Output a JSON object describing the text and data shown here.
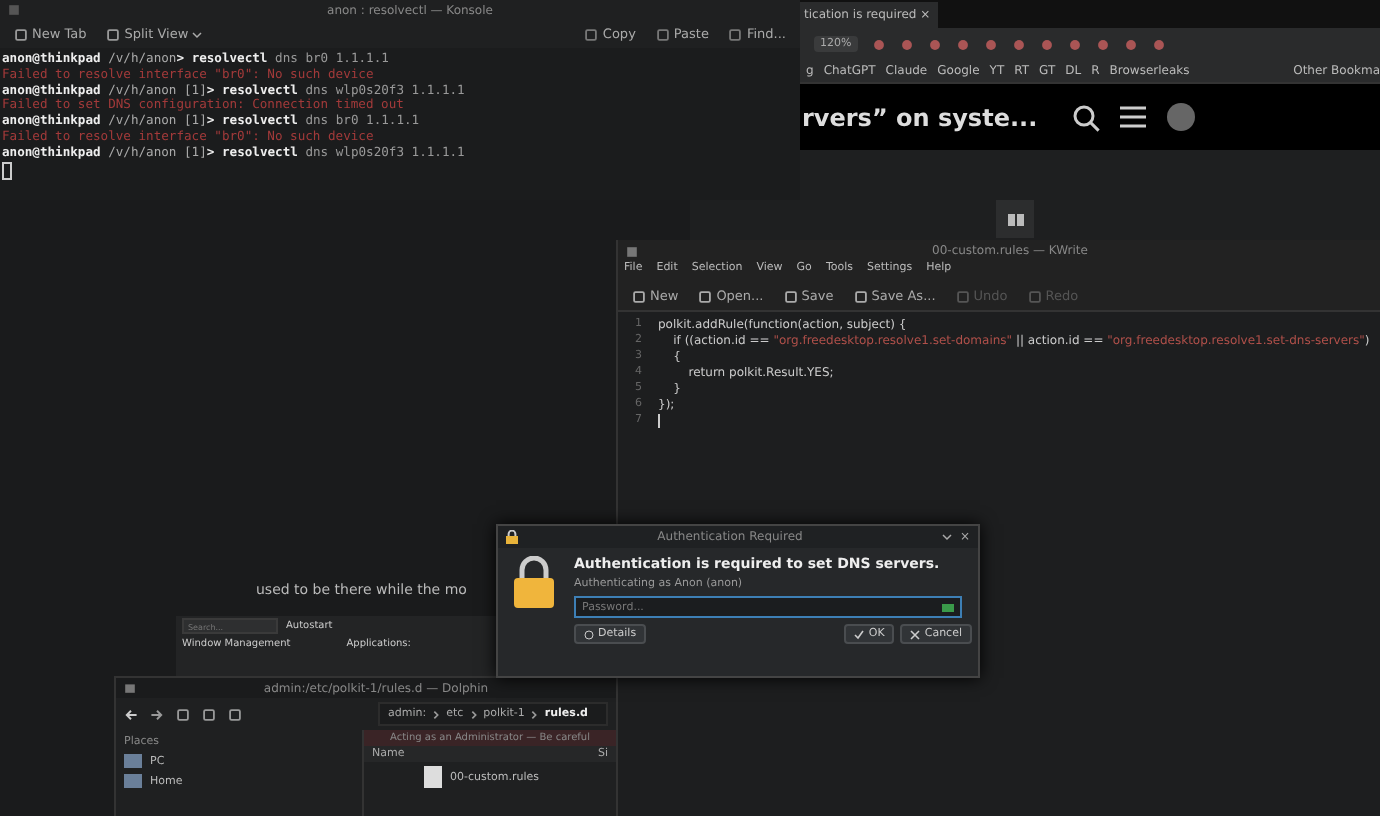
{
  "browser": {
    "tab": {
      "label": "tication is required",
      "close": "×",
      "selected": true
    },
    "zoom": "120%",
    "bookmarks": [
      "g",
      "ChatGPT",
      "Claude",
      "Google",
      "YT",
      "RT",
      "GT",
      "DL",
      "R",
      "Browserleaks"
    ],
    "other_bookmarks": "Other Bookma",
    "page_heading": "rvers” on syste...",
    "page_text": "used to be there while the mo"
  },
  "settings": {
    "search_placeholder": "Search...",
    "page": "Autostart",
    "items": [
      "Window Management"
    ],
    "section": "Applications:"
  },
  "konsole": {
    "title": "anon : resolvectl — Konsole",
    "toolbar": [
      "New Tab",
      "Split View"
    ],
    "actions": [
      "Copy",
      "Paste",
      "Find..."
    ],
    "lines": [
      {
        "kind": "prompt",
        "prompt": "anon@thinkpad",
        "path": "/v/h/anon",
        "symbol": ">",
        "command": "resolvectl",
        "args": "dns br0 1.1.1.1"
      },
      {
        "kind": "error",
        "text": "Failed to resolve interface \"br0\": No such device"
      },
      {
        "kind": "prompt",
        "prompt": "anon@thinkpad",
        "path": "/v/h/anon",
        "status": "[1]",
        "symbol": ">",
        "command": "resolvectl",
        "args": "dns wlp0s20f3 1.1.1.1"
      },
      {
        "kind": "error",
        "text": "Failed to set DNS configuration: Connection timed out"
      },
      {
        "kind": "prompt",
        "prompt": "anon@thinkpad",
        "path": "/v/h/anon",
        "status": "[1]",
        "symbol": ">",
        "command": "resolvectl",
        "args": "dns br0 1.1.1.1"
      },
      {
        "kind": "error",
        "text": "Failed to resolve interface \"br0\": No such device"
      },
      {
        "kind": "prompt",
        "prompt": "anon@thinkpad",
        "path": "/v/h/anon",
        "status": "[1]",
        "symbol": ">",
        "command": "resolvectl",
        "args": "dns wlp0s20f3 1.1.1.1"
      }
    ]
  },
  "kwrite": {
    "title": "00-custom.rules — KWrite",
    "menu": [
      "File",
      "Edit",
      "Selection",
      "View",
      "Go",
      "Tools",
      "Settings",
      "Help"
    ],
    "toolbar": [
      {
        "label": "New",
        "disabled": false
      },
      {
        "label": "Open...",
        "disabled": false
      },
      {
        "label": "Save",
        "disabled": false
      },
      {
        "label": "Save As...",
        "disabled": false
      },
      {
        "label": "Undo",
        "disabled": true
      },
      {
        "label": "Redo",
        "disabled": true
      }
    ],
    "lines": [
      {
        "number": "1",
        "segments": [
          {
            "kind": "code",
            "text": "polkit.addRule(function(action, subject) {"
          }
        ]
      },
      {
        "number": "2",
        "segments": [
          {
            "kind": "code",
            "text": "    if ((action.id == "
          },
          {
            "kind": "string",
            "text": "\"org.freedesktop.resolve1.set-domains\""
          },
          {
            "kind": "code",
            "text": " || action.id == "
          },
          {
            "kind": "string",
            "text": "\"org.freedesktop.resolve1.set-dns-servers\""
          },
          {
            "kind": "code",
            "text": ")"
          }
        ]
      },
      {
        "number": "3",
        "segments": [
          {
            "kind": "code",
            "text": "    {"
          }
        ]
      },
      {
        "number": "4",
        "segments": [
          {
            "kind": "code",
            "text": "        return polkit.Result.YES;"
          }
        ]
      },
      {
        "number": "5",
        "segments": [
          {
            "kind": "code",
            "text": "    }"
          }
        ]
      },
      {
        "number": "6",
        "segments": [
          {
            "kind": "code",
            "text": "});"
          }
        ]
      },
      {
        "number": "7"
      }
    ]
  },
  "auth": {
    "title": "Authentication Required",
    "close": "×",
    "heading": "Authentication is required to set DNS servers.",
    "subtitle": "Authenticating as Anon (anon)",
    "password": {
      "placeholder": "Password..."
    },
    "details": "Details",
    "ok": "OK",
    "cancel": "Cancel"
  },
  "dolphin": {
    "title": "admin:/etc/polkit-1/rules.d — Dolphin",
    "breadcrumb": [
      "admin:",
      "etc",
      "polkit-1",
      "rules.d"
    ],
    "places_heading": "Places",
    "places": [
      {
        "label": "PC",
        "selected": false
      },
      {
        "label": "Home",
        "selected": false
      }
    ],
    "banner": "Acting as an Administrator — Be careful",
    "columns": [
      "Name",
      "Si"
    ],
    "files": [
      "00-custom.rules"
    ]
  }
}
